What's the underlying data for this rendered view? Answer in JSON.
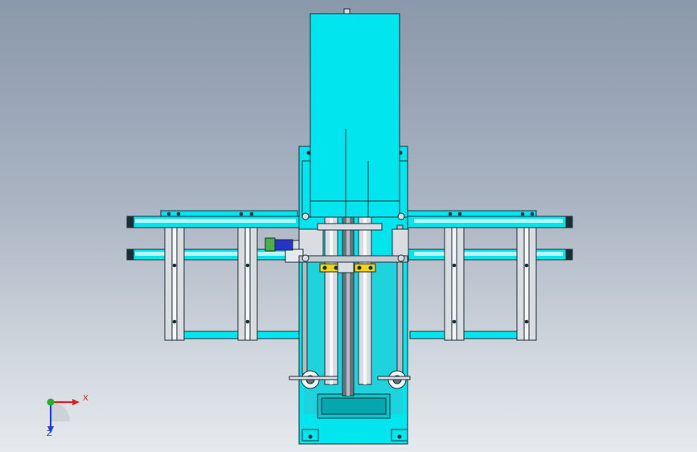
{
  "colors": {
    "part_fill": "#00e5ee",
    "part_stroke": "#1a2f36",
    "metal_light": "#d9dde2",
    "metal_dark": "#6a747c",
    "clamp_yellow": "#f2d21b",
    "motor_blue": "#2634c9",
    "motor_green": "#46b04a",
    "axis_x": "#e02020",
    "axis_y": "#22b322",
    "axis_z": "#2040d8"
  },
  "triad": {
    "x_label": "X",
    "z_label": "Z",
    "x_icon": "axis-x-arrow",
    "y_icon": "axis-y-dot",
    "z_icon": "axis-z-arrow"
  }
}
